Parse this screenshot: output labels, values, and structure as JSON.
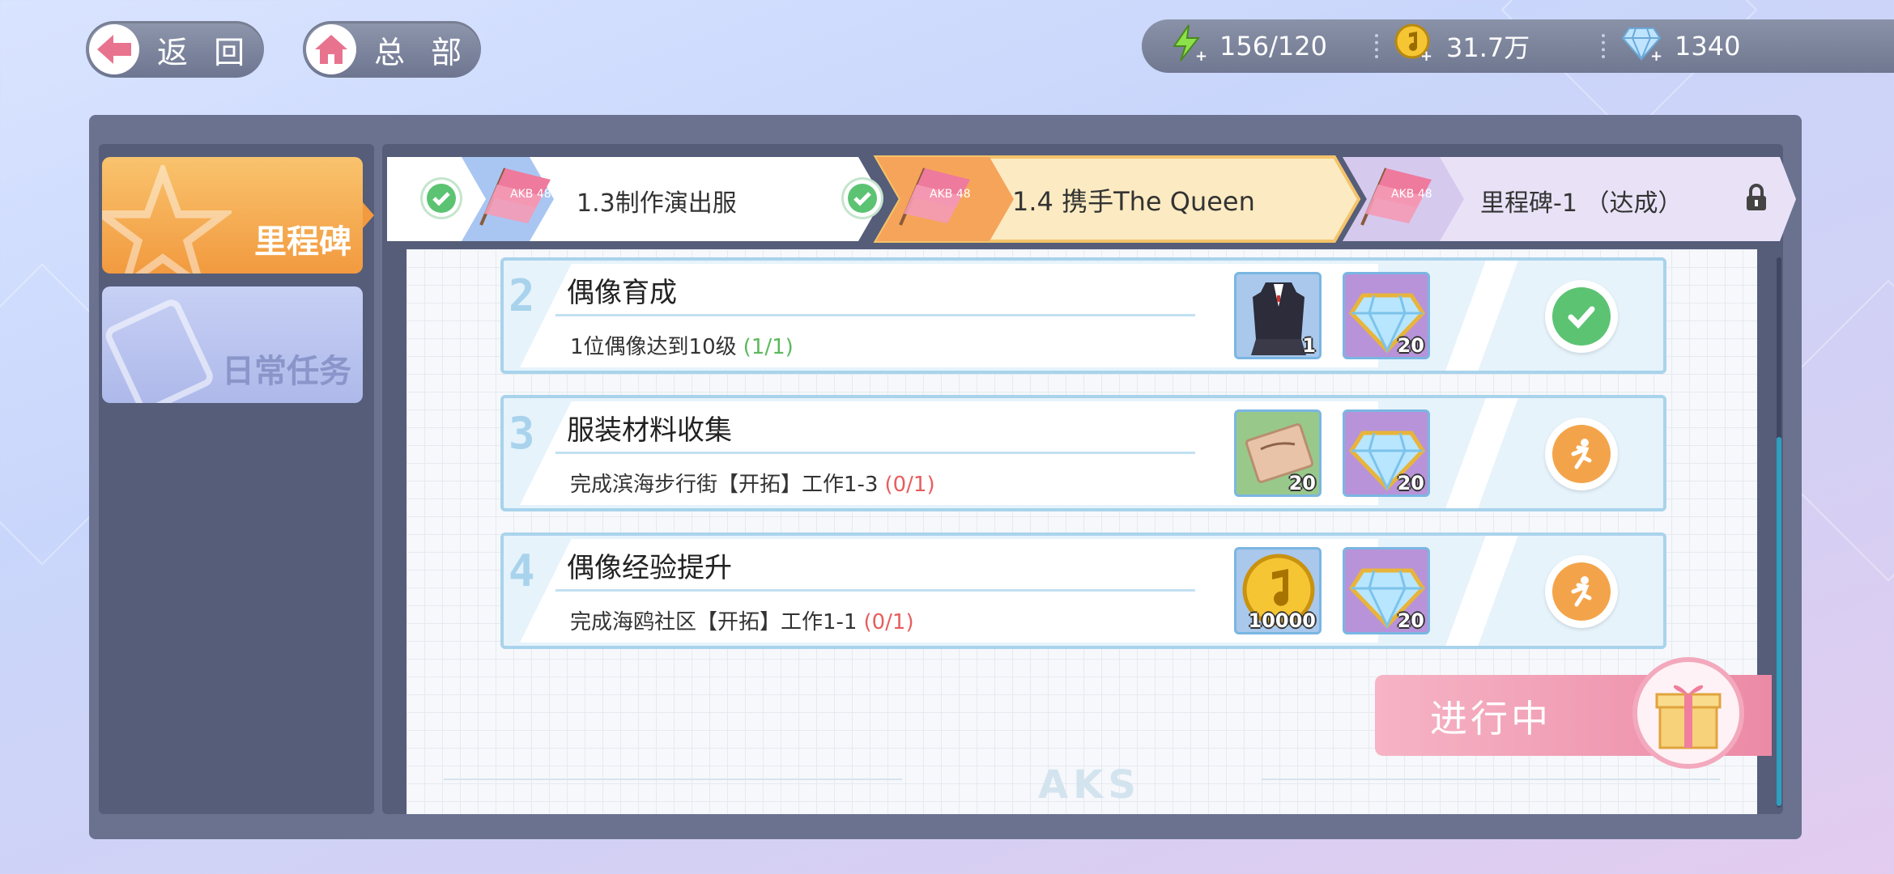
{
  "nav": {
    "back_label": "返 回",
    "home_label": "总 部"
  },
  "resources": {
    "stamina": "156/120",
    "coins": "31.7万",
    "diamonds": "1340"
  },
  "sidebar": {
    "items": [
      {
        "label": "里程碑"
      },
      {
        "label": "日常任务"
      }
    ]
  },
  "tabs": [
    {
      "label": "1.3制作演出服"
    },
    {
      "label": "1.4 携手The Queen"
    },
    {
      "label": "里程碑-1 （达成）"
    }
  ],
  "flag_text": "AKB 48",
  "tasks": [
    {
      "num": "2",
      "title": "偶像育成",
      "desc": "1位偶像达到10级",
      "progress": "(1/1)",
      "rewards": [
        {
          "icon": "outfit-icon",
          "count": "1"
        },
        {
          "icon": "diamond-icon",
          "count": "20"
        }
      ],
      "status": "done"
    },
    {
      "num": "3",
      "title": "服装材料收集",
      "desc": "完成滨海步行街【开拓】工作1-3",
      "progress": "(0/1)",
      "rewards": [
        {
          "icon": "material-card-icon",
          "count": "20"
        },
        {
          "icon": "diamond-icon",
          "count": "20"
        }
      ],
      "status": "go"
    },
    {
      "num": "4",
      "title": "偶像经验提升",
      "desc": "完成海鸥社区【开拓】工作1-1",
      "progress": "(0/1)",
      "rewards": [
        {
          "icon": "coin-icon",
          "count": "10000"
        },
        {
          "icon": "diamond-icon",
          "count": "20"
        }
      ],
      "status": "go"
    }
  ],
  "in_progress_label": "进行中",
  "footer_logo": "AKS",
  "colors": {
    "done_progress": "#5cb85c",
    "pending_progress": "#e85d5d",
    "accent_orange": "#f3a44a",
    "done_green": "#5cc372"
  }
}
